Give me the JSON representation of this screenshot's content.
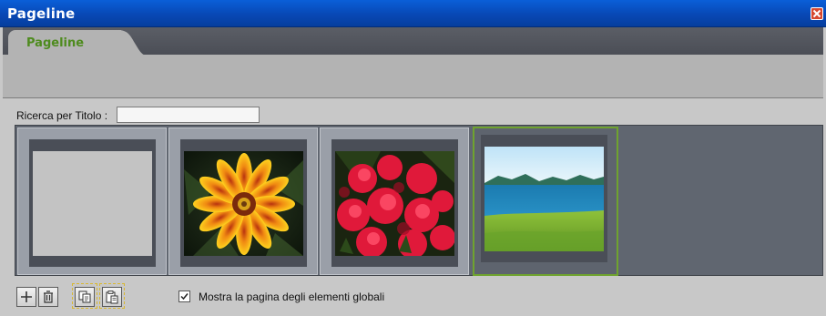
{
  "window": {
    "title": "Pageline",
    "close_icon": "close-icon"
  },
  "tabs": [
    {
      "label": "Pageline",
      "active": true
    }
  ],
  "search": {
    "label": "Ricerca per Titolo :",
    "value": "",
    "placeholder": ""
  },
  "pages": [
    {
      "name": "blank-page",
      "image": "empty",
      "selected": false
    },
    {
      "name": "flower-orange-page",
      "image": "orange gazania flower",
      "selected": false
    },
    {
      "name": "flower-red-page",
      "image": "red flowers",
      "selected": false
    },
    {
      "name": "landscape-sea-page",
      "image": "sea and green meadow landscape",
      "selected": true
    }
  ],
  "toolbar": {
    "add_icon": "plus-icon",
    "delete_icon": "trash-icon",
    "copy_icon": "copy-icon",
    "paste_icon": "paste-icon",
    "checkbox_checked": true,
    "checkbox_label": "Mostra la pagina degli elementi globali"
  },
  "colors": {
    "title_bar": "#0848b5",
    "tab_label": "#4e8b1e",
    "selected_border": "#6fa32e",
    "gallery_bg": "#606670"
  }
}
